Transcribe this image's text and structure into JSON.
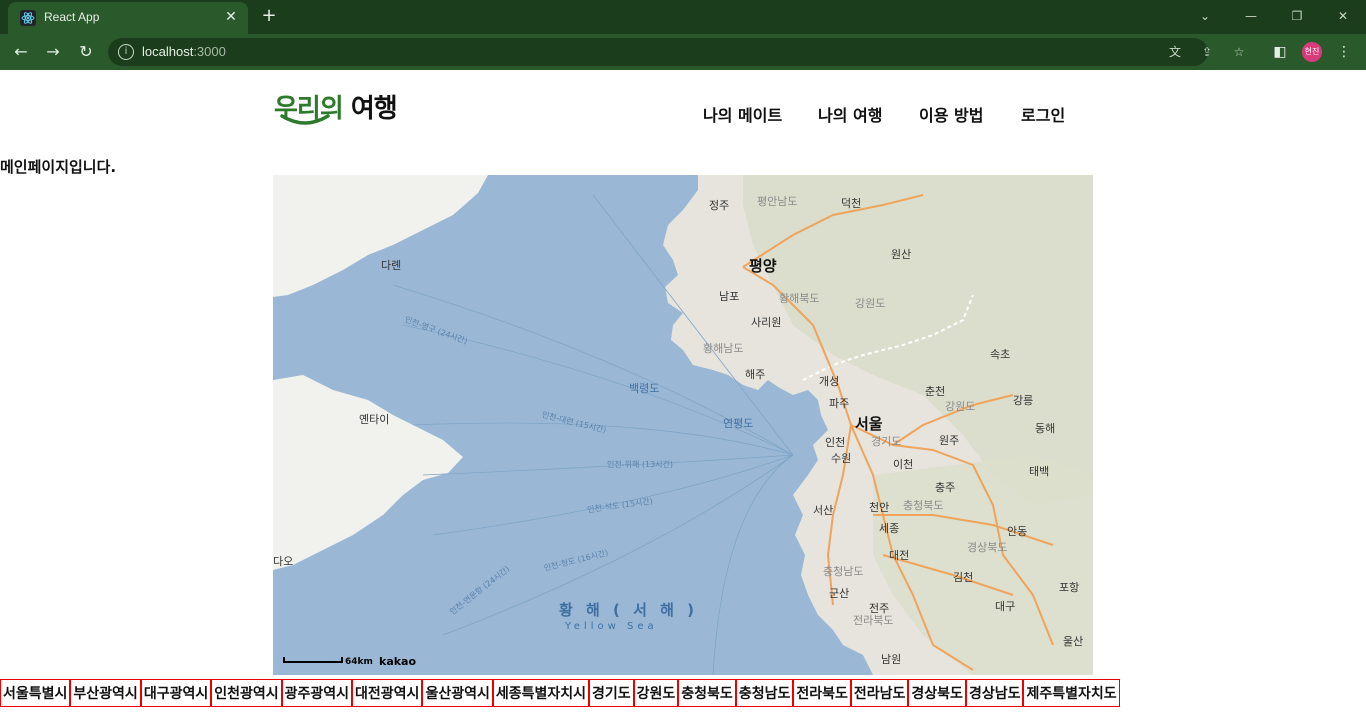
{
  "browser": {
    "tab_title": "React App",
    "url_host": "localhost",
    "url_port": ":3000",
    "profile_initials": "현진",
    "icons": {
      "favicon": "react-icon",
      "close": "close-icon",
      "new_tab": "plus-icon",
      "back": "arrow-left-icon",
      "forward": "arrow-right-icon",
      "reload": "reload-icon",
      "info": "info-icon",
      "translate": "translate-icon",
      "share": "share-icon",
      "bookmark": "star-icon",
      "side_panel": "side-panel-icon",
      "menu": "kebab-menu-icon"
    }
  },
  "header": {
    "logo_part1": "우리의",
    "logo_part2": " 여행",
    "nav": [
      "나의 메이트",
      "나의 여행",
      "이용 방법",
      "로그인"
    ]
  },
  "main": {
    "message": "메인페이지입니다."
  },
  "map": {
    "scale_label": "64km",
    "attribution": "kakao",
    "labels": {
      "pyongyang": "평양",
      "seoul": "서울",
      "nampo": "남포",
      "sariwon": "사리원",
      "haeju": "해주",
      "kaesong": "개성",
      "paju": "파주",
      "incheon": "인천",
      "suwon": "수원",
      "icheon": "이천",
      "wonju": "원주",
      "chuncheon": "춘천",
      "gangneung": "강릉",
      "sokcho": "속초",
      "donghae": "동해",
      "chungju": "충주",
      "cheonan": "천안",
      "seosan": "서산",
      "sejong": "세종",
      "daejeon": "대전",
      "gimcheon": "김천",
      "andong": "안동",
      "pohang": "포항",
      "daegu": "대구",
      "ulsan": "울산",
      "gunsan": "군산",
      "jeonju": "전주",
      "namwon": "남원",
      "wonsan": "원산",
      "jeongju": "정주",
      "deokcheon": "덕천",
      "taebaek": "태백",
      "dalian": "다롄",
      "yantai": "옌타이",
      "gyeonggido": "경기도",
      "gangwondo_s": "강원도",
      "gangwondo_n": "강원도",
      "chungbuk": "충청북도",
      "chungnam": "충청남도",
      "jeonbuk": "전라북도",
      "gyeongbuk": "경상북도",
      "hwanghaebukdo": "황해북도",
      "hwanghaenamdo": "황해남도",
      "pyongannamdo": "평안남도",
      "baengnyeongdo": "백령도",
      "yeonpyeongdo": "연평도",
      "sea_ko": "황 해 ( 서 해 )",
      "sea_en": "Yellow Sea",
      "daewo": "다오",
      "route1": "인천-영구 (24시간)",
      "route2": "인천-대련 (15시간)",
      "route3": "인천-위해 (13시간)",
      "route4": "인천-석도 (15시간)",
      "route5": "인천-청도 (16시간)",
      "route6": "인천-연운항 (24시간)"
    }
  },
  "regions": [
    "서울특별시",
    "부산광역시",
    "대구광역시",
    "인천광역시",
    "광주광역시",
    "대전광역시",
    "울산광역시",
    "세종특별자치시",
    "경기도",
    "강원도",
    "충청북도",
    "충청남도",
    "전라북도",
    "전라남도",
    "경상북도",
    "경상남도",
    "제주특별자치도"
  ]
}
